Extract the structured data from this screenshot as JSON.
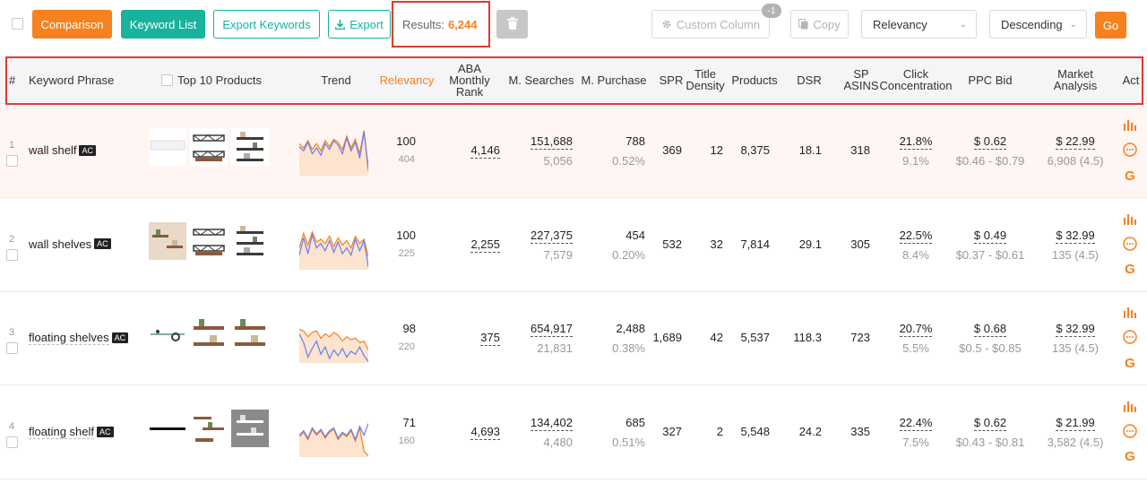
{
  "toolbar": {
    "comparison": "Comparison",
    "keyword_list": "Keyword List",
    "export_keywords": "Export Keywords",
    "export": "Export",
    "results_label": "Results:",
    "results_count": "6,244",
    "custom_column": "Custom Column",
    "custom_column_badge": "-1",
    "copy": "Copy",
    "sort_by": "Relevancy",
    "sort_order": "Descending",
    "go": "Go"
  },
  "columns": {
    "num": "#",
    "keyword": "Keyword Phrase",
    "top10": "Top 10 Products",
    "trend": "Trend",
    "relevancy": "Relevancy",
    "aba_rank": "ABA Monthly Rank",
    "searches": "M. Searches",
    "purchase": "M. Purchase",
    "spr": "SPR",
    "title_density": "Title Density",
    "products": "Products",
    "dsr": "DSR",
    "sp_asins": "SP ASINS",
    "click_conc": "Click Concentration",
    "ppc_bid": "PPC Bid",
    "market": "Market Analysis",
    "act": "Act"
  },
  "rows": [
    {
      "n": "1",
      "keyword": "wall shelf",
      "ac": "AC",
      "relevancy": "100",
      "relevancy_sub": "404",
      "aba": "4,146",
      "searches": "151,688",
      "searches_sub": "5,056",
      "purchase": "788",
      "purchase_sub": "0.52%",
      "spr": "369",
      "title_density": "12",
      "products": "8,375",
      "dsr": "18.1",
      "sp_asins": "318",
      "click": "21.8%",
      "click_sub": "9.1%",
      "ppc": "$ 0.62",
      "ppc_range": "$0.46 - $0.79",
      "market": "$ 22.99",
      "market_sub": "6,908 (4.5)",
      "trend": {
        "blue": [
          40,
          34,
          46,
          30,
          38,
          28,
          44,
          36,
          48,
          42,
          30,
          52,
          34,
          46,
          24,
          60,
          12
        ],
        "orange": [
          44,
          38,
          48,
          36,
          44,
          34,
          48,
          40,
          50,
          46,
          36,
          54,
          38,
          50,
          30,
          62,
          6
        ]
      }
    },
    {
      "n": "2",
      "keyword": "wall shelves",
      "ac": "AC",
      "relevancy": "100",
      "relevancy_sub": "225",
      "aba": "2,255",
      "searches": "227,375",
      "searches_sub": "7,579",
      "purchase": "454",
      "purchase_sub": "0.20%",
      "spr": "532",
      "title_density": "32",
      "products": "7,814",
      "dsr": "29.1",
      "sp_asins": "305",
      "click": "22.5%",
      "click_sub": "8.4%",
      "ppc": "$ 0.49",
      "ppc_range": "$0.37 - $0.61",
      "market": "$ 32.99",
      "market_sub": "135 (4.5)",
      "trend": {
        "blue": [
          20,
          44,
          22,
          48,
          30,
          36,
          26,
          40,
          24,
          38,
          22,
          30,
          20,
          42,
          26,
          40,
          4
        ],
        "orange": [
          30,
          50,
          34,
          52,
          38,
          42,
          36,
          46,
          32,
          44,
          34,
          40,
          30,
          46,
          36,
          42,
          18
        ]
      }
    },
    {
      "n": "3",
      "keyword": "floating shelves",
      "ac": "AC",
      "relevancy": "98",
      "relevancy_sub": "220",
      "aba": "375",
      "searches": "654,917",
      "searches_sub": "21,831",
      "purchase": "2,488",
      "purchase_sub": "0.38%",
      "spr": "1,689",
      "title_density": "42",
      "products": "5,537",
      "dsr": "118.3",
      "sp_asins": "723",
      "click": "20.7%",
      "click_sub": "5.5%",
      "ppc": "$ 0.68",
      "ppc_range": "$0.5 - $0.85",
      "market": "$ 32.99",
      "market_sub": "135 (4.5)",
      "trend": {
        "blue": [
          40,
          28,
          8,
          20,
          30,
          12,
          22,
          6,
          18,
          10,
          20,
          8,
          16,
          12,
          22,
          10,
          2
        ],
        "orange": [
          46,
          44,
          36,
          42,
          44,
          34,
          40,
          36,
          42,
          38,
          30,
          36,
          32,
          34,
          28,
          30,
          18
        ]
      }
    },
    {
      "n": "4",
      "keyword": "floating shelf",
      "ac": "AC",
      "relevancy": "71",
      "relevancy_sub": "160",
      "aba": "4,693",
      "searches": "134,402",
      "searches_sub": "4,480",
      "purchase": "685",
      "purchase_sub": "0.51%",
      "spr": "327",
      "title_density": "2",
      "products": "5,548",
      "dsr": "24.2",
      "sp_asins": "335",
      "click": "22.4%",
      "click_sub": "7.5%",
      "ppc": "$ 0.62",
      "ppc_range": "$0.43 - $0.81",
      "market": "$ 21.99",
      "market_sub": "3,582 (4.5)",
      "trend": {
        "blue": [
          30,
          36,
          26,
          40,
          32,
          38,
          28,
          36,
          40,
          26,
          34,
          30,
          38,
          24,
          42,
          30,
          46
        ],
        "orange": [
          28,
          34,
          24,
          38,
          30,
          36,
          26,
          34,
          38,
          24,
          32,
          28,
          36,
          22,
          40,
          8,
          2
        ]
      }
    }
  ],
  "colors": {
    "accent": "#f5811f",
    "teal": "#17b39c",
    "blue": "#6b7ef0",
    "highlight": "#e03a2e"
  }
}
